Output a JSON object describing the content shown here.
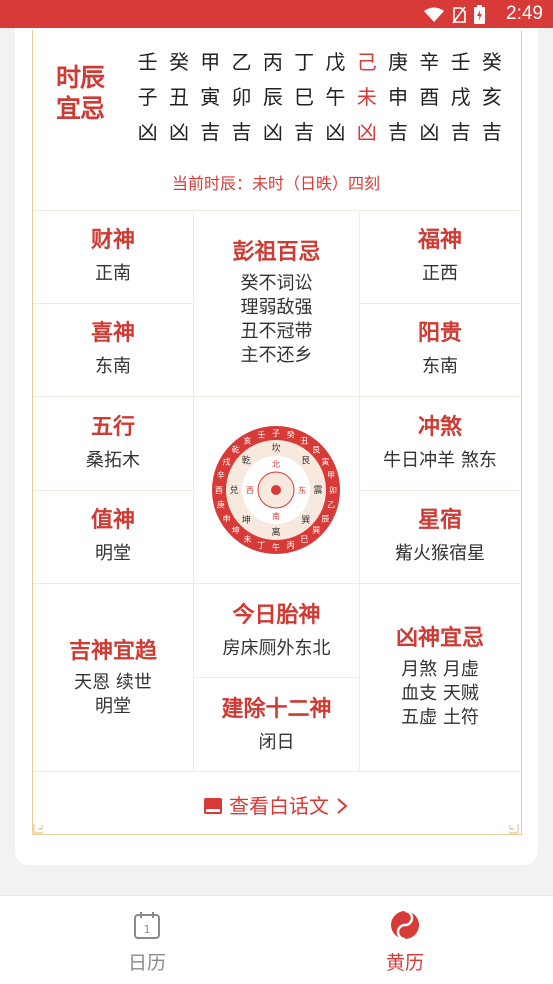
{
  "status": {
    "time": "2:49"
  },
  "shichen": {
    "label": "时辰宜忌",
    "stems": [
      "壬",
      "癸",
      "甲",
      "乙",
      "丙",
      "丁",
      "戊",
      "己",
      "庚",
      "辛",
      "壬",
      "癸"
    ],
    "branches": [
      "子",
      "丑",
      "寅",
      "卯",
      "辰",
      "巳",
      "午",
      "未",
      "申",
      "酉",
      "戌",
      "亥"
    ],
    "luck": [
      "凶",
      "凶",
      "吉",
      "吉",
      "凶",
      "吉",
      "凶",
      "凶",
      "吉",
      "凶",
      "吉",
      "吉"
    ],
    "current_text": "当前时辰：未时（日昳）四刻"
  },
  "cells": {
    "caishen": {
      "title": "财神",
      "value": "正南"
    },
    "xishen": {
      "title": "喜神",
      "value": "东南"
    },
    "pengzu": {
      "title": "彭祖百忌",
      "lines": [
        "癸不词讼",
        "理弱敌强",
        "丑不冠带",
        "主不还乡"
      ]
    },
    "fushen": {
      "title": "福神",
      "value": "正西"
    },
    "yanggui": {
      "title": "阳贵",
      "value": "东南"
    },
    "wuxing": {
      "title": "五行",
      "value": "桑拓木"
    },
    "zhishen": {
      "title": "值神",
      "value": "明堂"
    },
    "chongsha": {
      "title": "冲煞",
      "value": "牛日冲羊 煞东"
    },
    "xingxiu": {
      "title": "星宿",
      "value": "觜火猴宿星"
    },
    "jishen": {
      "title": "吉神宜趋",
      "lines": [
        "天恩 续世",
        "明堂"
      ]
    },
    "taishen": {
      "title": "今日胎神",
      "value": "房床厕外东北"
    },
    "jianchu": {
      "title": "建除十二神",
      "value": "闭日"
    },
    "xiongshen": {
      "title": "凶神宜忌",
      "lines": [
        "月煞 月虚",
        "血支 天贼",
        "五虚 土符"
      ]
    }
  },
  "compass": {
    "outer": [
      "壬",
      "子",
      "癸",
      "丑",
      "艮",
      "寅",
      "甲",
      "卯",
      "乙",
      "辰",
      "巽",
      "巳",
      "丙",
      "午",
      "丁",
      "未",
      "坤",
      "申",
      "庚",
      "酉",
      "辛",
      "戌",
      "乾",
      "亥"
    ],
    "trigrams": [
      "坎",
      "艮",
      "震",
      "巽",
      "离",
      "坤",
      "兑",
      "乾"
    ],
    "center": [
      "北",
      "东",
      "南",
      "西"
    ]
  },
  "link": {
    "label": "查看白话文"
  },
  "tabs": [
    {
      "label": "日历",
      "icon_text": "1"
    },
    {
      "label": "黄历"
    }
  ],
  "colors": {
    "accent": "#d83a37",
    "title_red": "#cf3a33",
    "frame_gold": "#e8cf99"
  }
}
